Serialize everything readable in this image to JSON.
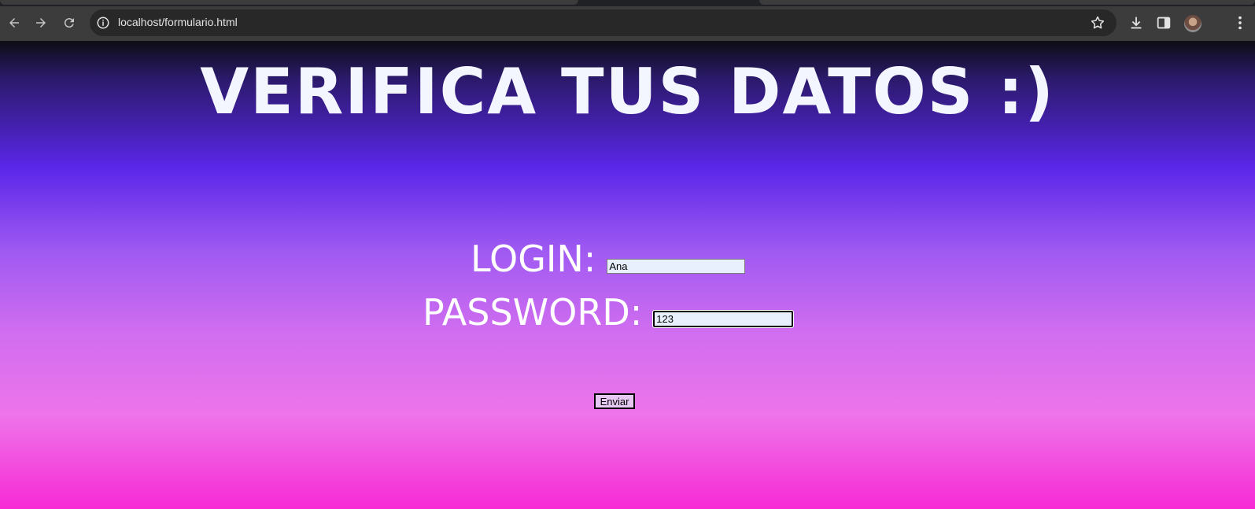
{
  "browser": {
    "url": "localhost/formulario.html",
    "icons": {
      "back": "arrow-left-icon",
      "forward": "arrow-right-icon",
      "reload": "reload-icon",
      "site_info": "info-icon",
      "bookmark": "star-icon",
      "downloads": "download-icon",
      "side_panel": "side-panel-icon",
      "profile": "avatar",
      "menu": "kebab-menu-icon"
    }
  },
  "page": {
    "heading": "VERIFICA TUS DATOS :)",
    "login": {
      "label": "LOGIN:",
      "value": "Ana"
    },
    "password": {
      "label": "PASSWORD:",
      "value": "123"
    },
    "submit_label": "Enviar",
    "colors": {
      "gradient": [
        "#0d0d14",
        "#5a26e8",
        "#d06df0",
        "#f72ad4"
      ],
      "heading_text": "#f3f5ff"
    }
  }
}
